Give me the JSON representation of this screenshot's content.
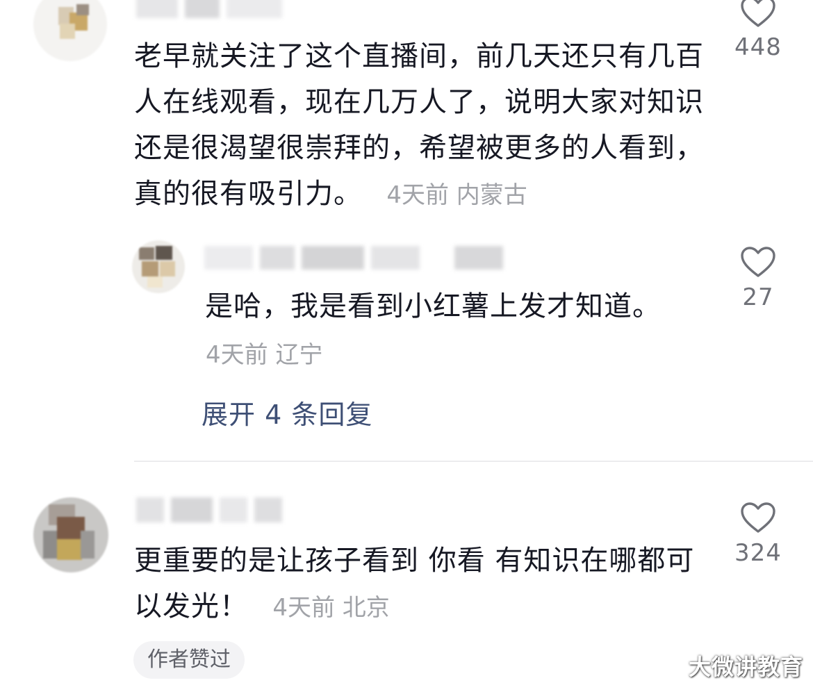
{
  "comments": [
    {
      "text": "老早就关注了这个直播间，前几天还只有几百人在线观看，现在几万人了，说明大家对知识还是很渴望很崇拜的，希望被更多的人看到，真的很有吸引力。",
      "time": "4天前",
      "location": "内蒙古",
      "likes": "448",
      "replies": [
        {
          "text": "是哈，我是看到小红薯上发才知道。",
          "time": "4天前",
          "location": "辽宁",
          "likes": "27"
        }
      ],
      "expand_label": "展开 4 条回复"
    },
    {
      "text": "更重要的是让孩子看到 你看 有知识在哪都可以发光！",
      "time": "4天前",
      "location": "北京",
      "likes": "324",
      "badge": "作者赞过"
    }
  ],
  "icons": {
    "like": "heart-outline-icon"
  },
  "watermark": "大微讲教育",
  "colors": {
    "text": "#161823",
    "meta": "#a1a3a8",
    "link": "#3e4f75",
    "divider": "#ececee"
  }
}
